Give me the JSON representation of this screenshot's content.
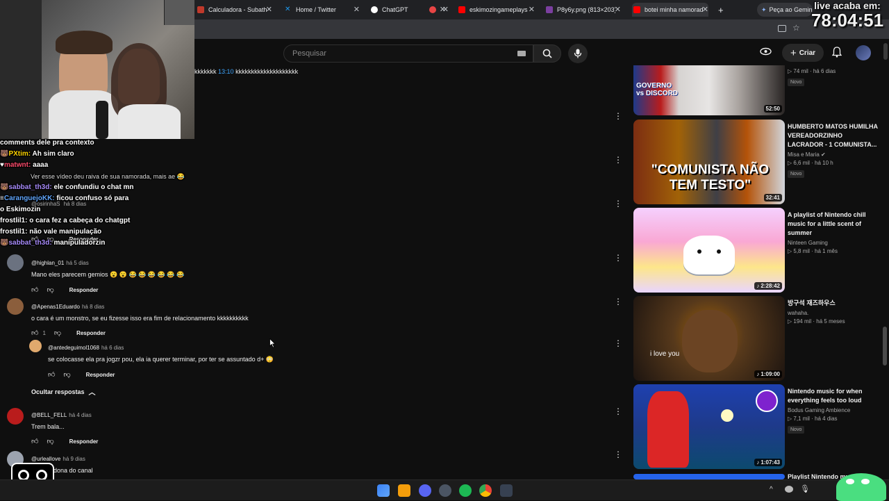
{
  "browser": {
    "tabs": [
      {
        "title": "Calculadora - Subath",
        "color": "#c0392b"
      },
      {
        "title": "Home / Twitter",
        "color": "#1d9bf0"
      },
      {
        "title": "ChatGPT",
        "color": "#ffffff"
      },
      {
        "title": "",
        "color": "#e84545"
      },
      {
        "title": "eskimozingameplaysh",
        "color": "#ff0000"
      },
      {
        "title": "P8y6y.png (813×203)",
        "color": "#7b3fa0"
      },
      {
        "title": "botei minha namorad",
        "color": "#ff0000"
      }
    ],
    "gemini_button": "Peça ao Gemini",
    "new_tab": "+"
  },
  "stream": {
    "timer_label": "live acaba em:",
    "timer_value": "78:04:51"
  },
  "youtube": {
    "search_placeholder": "Pesquisar",
    "create_label": "Criar"
  },
  "top_line": {
    "pre": "kkkkkkk",
    "timestamp": "13:10",
    "post": "kkkkkkkkkkkkkkkkkkkk"
  },
  "chat": [
    {
      "user": "",
      "text": "comments dele pra contexto",
      "color": "#ffffff"
    },
    {
      "user": "PXtim:",
      "text": "Ah sim claro",
      "color": "#ffd400"
    },
    {
      "user": "matwnt:",
      "text": "aaaa",
      "color": "#ff4d6d"
    },
    {
      "user": "",
      "text": "Ver esse vídeo deu raiva de sua namorada, mais ae 😂",
      "color": "#cccccc"
    },
    {
      "user": "sabbat_th3d:",
      "text": "ele confundiu o chat mn",
      "color": "#a78bfa"
    },
    {
      "user": "CaranguejoKK:",
      "text": "ficou confuso só para",
      "color": "#60a5fa"
    },
    {
      "user": "",
      "text": "o Eskimozin",
      "color": "#ffffff"
    },
    {
      "user": "frostlil1:",
      "text": "o cara fez a cabeça do chatgpt",
      "color": "#ffffff"
    },
    {
      "user": "frostlil1:",
      "text": "não vale manipulação",
      "color": "#ffffff"
    },
    {
      "user": "sabbat_th3d:",
      "text": "manipuladorzin",
      "color": "#a78bfa"
    }
  ],
  "comments": [
    {
      "author": "@highlan_01",
      "time": "há 5 dias",
      "text": "Mano eles parecem gemios 😮 😮 😂 😂 😂 😂 😂 😂",
      "likes": "",
      "reply": "Responder",
      "avatar": "#6b7280"
    },
    {
      "author": "@Apenas1Eduardo",
      "time": "há 8 dias",
      "text": "o cara é um monstro, se eu fizesse isso era fim de relacionamento kkkkkkkkkk",
      "likes": "1",
      "reply": "Responder",
      "avatar": "#8b5e3c"
    },
    {
      "author": "@antedeguimol1068",
      "time": "há 6 dias",
      "text": "se colocasse ela pra jogzr pou, ela ia querer terminar, por ter se assuntado d+ 😳",
      "likes": "",
      "reply": "Responder",
      "avatar": "#e0a96d"
    },
    {
      "author": "@BELL_FELL",
      "time": "há 4 dias",
      "text": "Trem bala...",
      "likes": "",
      "reply": "Responder",
      "avatar": "#b91c1c"
    },
    {
      "author": "@urleallove",
      "time": "há 9 dias",
      "text": "...ya da dona do canal",
      "likes": "",
      "reply": "Responder",
      "avatar": "#9ca3af"
    }
  ],
  "hide_replies": "Ocultar respostas",
  "partial_comments": {
    "author2": "@osirinhaS",
    "time2": "há 8 dias",
    "reply_top": "Responder"
  },
  "sidebar": [
    {
      "title": "",
      "channel": "",
      "meta": "74 mil · há 6 dias",
      "badge": "Novo",
      "duration": "52:50",
      "thumb_text": "GOVERNO vs DISCORD"
    },
    {
      "title": "HUMBERTO MATOS HUMILHA VEREADORZINHO LACRADOR - 1 COMUNISTA...",
      "channel": "Misa e Maria",
      "meta": "6,6 mil · há 10 h",
      "badge": "Novo",
      "duration": "32:41",
      "thumb_text": "\"COMUNISTA NÃO TEM TESTO\""
    },
    {
      "title": "A playlist of Nintendo chill music for a little scent of summer",
      "channel": "Ninteen Gaming",
      "meta": "5,8 mil · há 1 mês",
      "badge": "",
      "duration": "2:28:42",
      "thumb_text": ""
    },
    {
      "title": "방구석 재즈하우스",
      "channel": "wahaha.",
      "meta": "194 mil · há 5 meses",
      "badge": "",
      "duration": "1:09:00",
      "thumb_text": "i love you"
    },
    {
      "title": "Nintendo music for when everything feels too loud",
      "channel": "Bodus Gaming Ambience",
      "meta": "7,1 mil · há 4 dias",
      "badge": "Novo",
      "duration": "1:07:43",
      "thumb_text": ""
    },
    {
      "title": "Playlist Nintendo mu...",
      "channel": "",
      "meta": "",
      "badge": "",
      "duration": "",
      "thumb_text": ""
    }
  ]
}
